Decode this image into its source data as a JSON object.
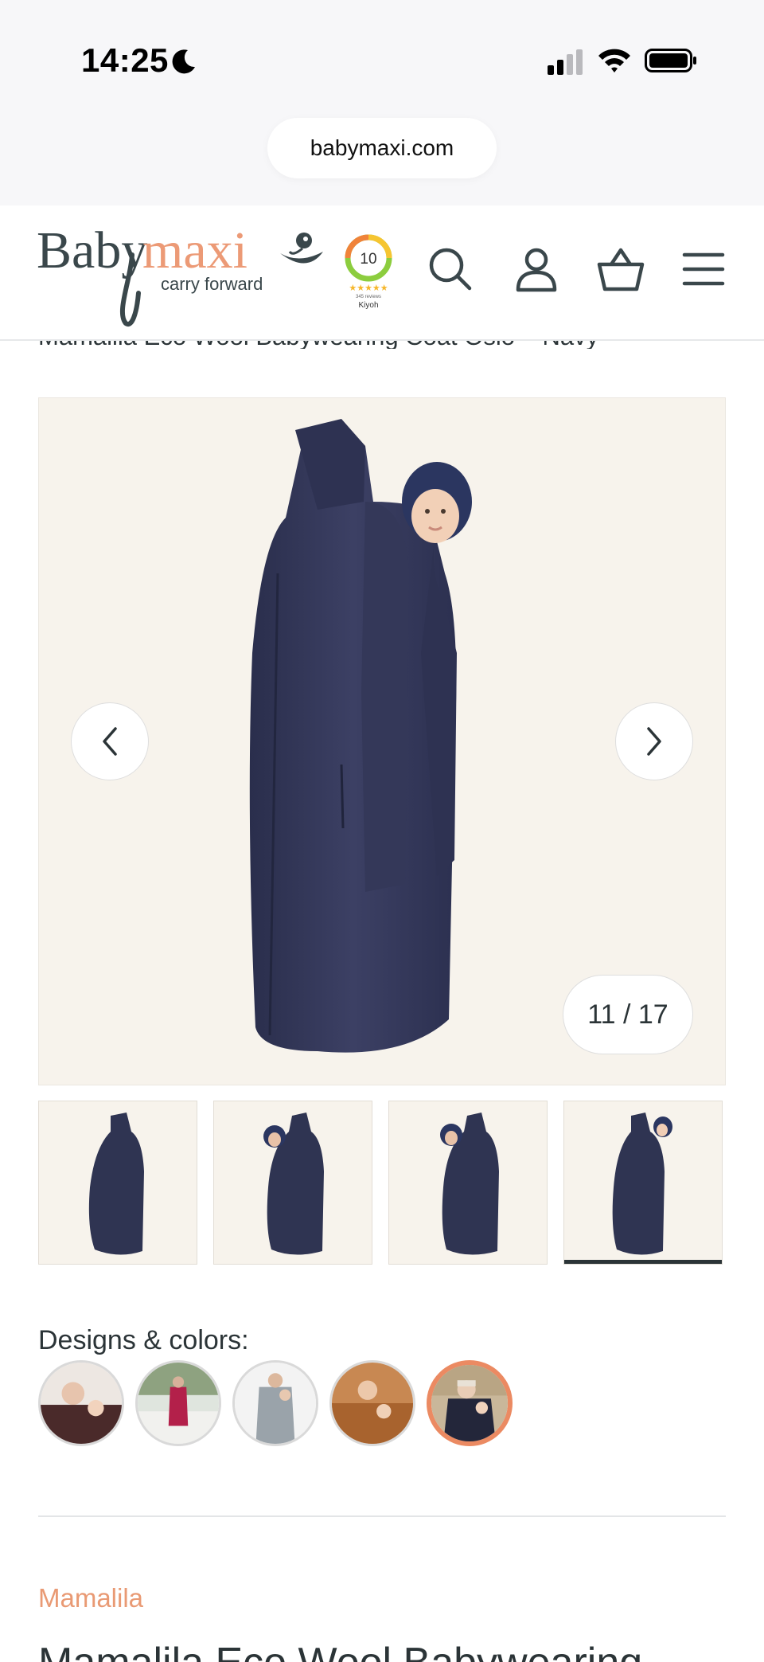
{
  "status_bar": {
    "time": "14:25",
    "moon": "moon-icon",
    "signal": "cellular-signal-icon",
    "wifi": "wifi-icon",
    "battery": "battery-icon"
  },
  "browser": {
    "url": "babymaxi.com"
  },
  "header": {
    "logo_main_dark": "Baby",
    "logo_main_accent": "maxi",
    "logo_tagline": "carry forward",
    "rating_score": "10",
    "rating_reviews": "345 reviews",
    "rating_source": "Kiyoh",
    "icons": [
      "search-icon",
      "account-icon",
      "basket-icon",
      "menu-icon"
    ]
  },
  "page": {
    "breadcrumb_title": "Mamalila Eco Wool Babywearing Coat Oslo – Navy",
    "gallery_counter": "11 / 17",
    "designs_label": "Designs & colors:",
    "brand": "Mamalila",
    "product_title": "Mamalila Eco Wool Babywearing"
  },
  "colors": {
    "accent": "#eb8a62",
    "navy": "#2f3452",
    "text": "#2b3437",
    "gallery_bg": "#f7f3ec"
  }
}
